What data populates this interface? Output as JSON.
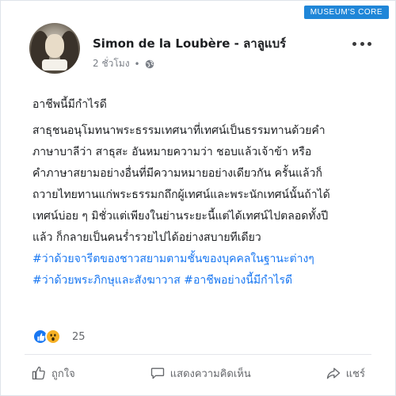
{
  "badge": "MUSEUM'S CORE",
  "post": {
    "author": "Simon de la Loubère - ลาลูแบร์",
    "time": "2 ชั่วโมง",
    "separator": "•",
    "title": "อาชีพนี้มีกำไรดี",
    "body_lines": [
      "สาธุชนอนุโมทนาพระธรรมเทศนาที่เทศน์เป็นธรรมทานด้วยคำ",
      "ภาษาบาลีว่า สาธุสะ อันหมายความว่า ชอบแล้วเจ้าข้า หรือ",
      "คำภาษาสยามอย่างอื่นที่มีความหมายอย่างเดียวกัน ครั้นแล้วก็",
      "ถวายไทยทานแก่พระธรรมกถึกผู้เทศน์และพระนักเทศน์นั้นถ้าได้",
      "เทศน์บ่อย ๆ มิชั่วแต่เพียงในย่านระยะนี้แต่ได้เทศน์ไปตลอดทั้งปี",
      "แล้ว ก็กลายเป็นคนร่ำรวยไปได้อย่างสบายทีเดียว"
    ],
    "hashtag_lines": [
      "#ว่าด้วยจารีตของชาวสยามตามชั้นของบุคคลในฐานะต่างๆ",
      "#ว่าด้วยพระภิกษุและสังฆาวาส #อาชีพอย่างนี้มีกำไรดี"
    ],
    "reaction_count": "25"
  },
  "actions": {
    "like": "ถูกใจ",
    "comment": "แสดงความคิดเห็น",
    "share": "แชร์"
  },
  "icons": {
    "globe": "globe-icon",
    "more": "more-horizontal-icon",
    "like_reaction": "like-reaction-icon",
    "wow_reaction": "wow-reaction-icon",
    "like_action": "thumbs-up-icon",
    "comment_action": "comment-bubble-icon",
    "share_action": "share-arrow-icon"
  },
  "colors": {
    "accent": "#1877f2",
    "badge": "#1f86d8",
    "wow": "#f7b125",
    "muted": "#65676b"
  }
}
